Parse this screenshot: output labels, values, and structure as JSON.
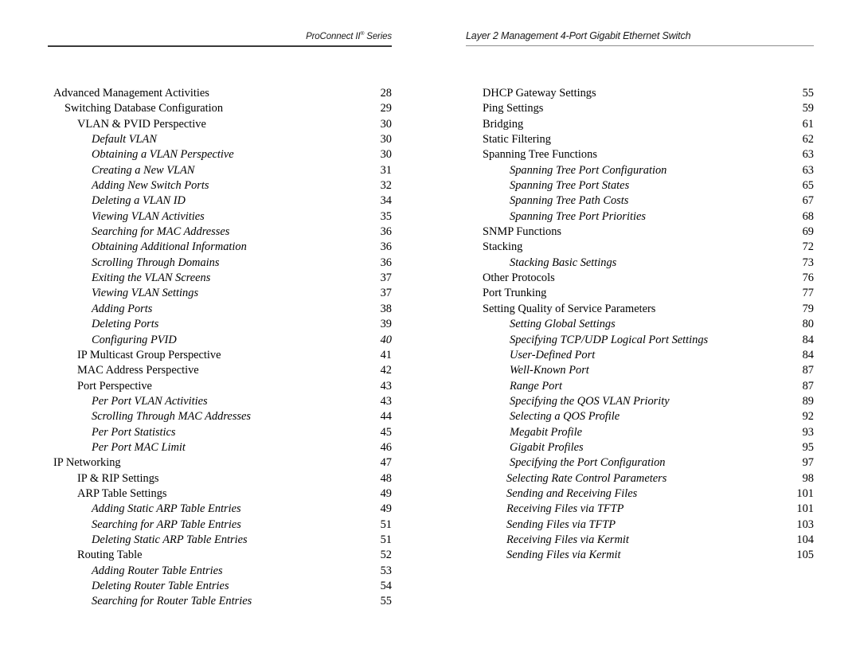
{
  "header": {
    "left_brand": "ProConnect II",
    "left_brand_mark": "®",
    "left_brand_suffix": " Series",
    "right_title": "Layer 2 Management 4-Port Gigabit Ethernet Switch"
  },
  "toc": {
    "left_column": [
      {
        "title": "Advanced Management Activities",
        "page": "28",
        "level": 1
      },
      {
        "title": "Switching Database Configuration",
        "page": "29",
        "level": 2
      },
      {
        "title": "VLAN & PVID Perspective",
        "page": "30",
        "level": 3
      },
      {
        "title": "Default VLAN",
        "page": "30",
        "level": 4
      },
      {
        "title": "Obtaining a VLAN Perspective",
        "page": "30",
        "level": 4
      },
      {
        "title": "Creating a New VLAN",
        "page": "31",
        "level": 4
      },
      {
        "title": "Adding New Switch Ports",
        "page": "32",
        "level": 4
      },
      {
        "title": "Deleting a VLAN ID",
        "page": "34",
        "level": 4
      },
      {
        "title": "Viewing VLAN Activities",
        "page": "35",
        "level": 4
      },
      {
        "title": "Searching for MAC Addresses",
        "page": "36",
        "level": 4
      },
      {
        "title": "Obtaining Additional Information",
        "page": "36",
        "level": 4
      },
      {
        "title": "Scrolling Through Domains",
        "page": "36",
        "level": 4
      },
      {
        "title": "Exiting the VLAN Screens",
        "page": "37",
        "level": 4
      },
      {
        "title": "Viewing VLAN Settings",
        "page": "37",
        "level": 4
      },
      {
        "title": "Adding Ports",
        "page": "38",
        "level": 4
      },
      {
        "title": "Deleting Ports",
        "page": "39",
        "level": 4
      },
      {
        "title": "Configuring PVID",
        "page": "40",
        "level": 4,
        "italic_page": true
      },
      {
        "title": "IP Multicast Group Perspective",
        "page": "41",
        "level": 3
      },
      {
        "title": "MAC Address Perspective",
        "page": "42",
        "level": 3
      },
      {
        "title": "Port Perspective",
        "page": "43",
        "level": 3
      },
      {
        "title": "Per Port VLAN Activities",
        "page": "43",
        "level": 4
      },
      {
        "title": "Scrolling Through MAC Addresses",
        "page": "44",
        "level": 4
      },
      {
        "title": "Per Port Statistics",
        "page": "45",
        "level": 4
      },
      {
        "title": "Per Port MAC Limit",
        "page": "46",
        "level": 4
      },
      {
        "title": "IP Networking",
        "page": "47",
        "level": 1
      },
      {
        "title": "IP & RIP Settings",
        "page": "48",
        "level": 3
      },
      {
        "title": "ARP Table Settings",
        "page": "49",
        "level": 3
      },
      {
        "title": "Adding Static ARP Table Entries",
        "page": "49",
        "level": 4
      },
      {
        "title": "Searching for ARP Table Entries",
        "page": "51",
        "level": 4
      },
      {
        "title": "Deleting Static ARP Table Entries",
        "page": "51",
        "level": 4
      },
      {
        "title": "Routing Table",
        "page": "52",
        "level": 3
      },
      {
        "title": "Adding Router Table Entries",
        "page": "53",
        "level": 4
      },
      {
        "title": "Deleting Router Table Entries",
        "page": "54",
        "level": 4
      },
      {
        "title": "Searching for Router Table Entries",
        "page": "55",
        "level": 4
      }
    ],
    "right_column": [
      {
        "title": "DHCP Gateway Settings",
        "page": "55",
        "level": 2
      },
      {
        "title": "Ping Settings",
        "page": "59",
        "level": 2
      },
      {
        "title": "Bridging",
        "page": "61",
        "level": 2
      },
      {
        "title": "Static Filtering",
        "page": "62",
        "level": 2
      },
      {
        "title": "Spanning Tree Functions",
        "page": "63",
        "level": 2
      },
      {
        "title": "Spanning Tree Port Configuration",
        "page": "63",
        "level": 4
      },
      {
        "title": "Spanning Tree Port States",
        "page": "65",
        "level": 4
      },
      {
        "title": "Spanning Tree Path Costs",
        "page": "67",
        "level": 4
      },
      {
        "title": "Spanning Tree Port Priorities",
        "page": "68",
        "level": 4
      },
      {
        "title": "SNMP Functions",
        "page": "69",
        "level": 2
      },
      {
        "title": "Stacking",
        "page": "72",
        "level": 2
      },
      {
        "title": "Stacking Basic Settings",
        "page": "73",
        "level": 4
      },
      {
        "title": "Other Protocols",
        "page": "76",
        "level": 2
      },
      {
        "title": "Port Trunking",
        "page": "77",
        "level": 2
      },
      {
        "title": "Setting Quality of Service Parameters",
        "page": "79",
        "level": 2
      },
      {
        "title": "Setting Global Settings",
        "page": "80",
        "level": 4
      },
      {
        "title": "Specifying TCP/UDP Logical Port Settings",
        "page": "84",
        "level": 4
      },
      {
        "title": "User-Defined Port",
        "page": "84",
        "level": 4
      },
      {
        "title": "Well-Known Port",
        "page": "87",
        "level": 4
      },
      {
        "title": "Range Port",
        "page": "87",
        "level": 4
      },
      {
        "title": "Specifying the QOS VLAN Priority",
        "page": "89",
        "level": 4
      },
      {
        "title": "Selecting a QOS Profile",
        "page": "92",
        "level": 4
      },
      {
        "title": "Megabit Profile",
        "page": "93",
        "level": 4
      },
      {
        "title": "Gigabit Profiles",
        "page": "95",
        "level": 4
      },
      {
        "title": "Specifying the Port Configuration",
        "page": "97",
        "level": 4
      },
      {
        "title": "Selecting Rate Control Parameters",
        "page": "98",
        "level": "4b"
      },
      {
        "title": "Sending and Receiving Files",
        "page": "101",
        "level": "4b"
      },
      {
        "title": "Receiving Files via TFTP",
        "page": "101",
        "level": "4b"
      },
      {
        "title": "Sending Files via TFTP",
        "page": "103",
        "level": "4b"
      },
      {
        "title": "Receiving Files via Kermit",
        "page": "104",
        "level": "4b"
      },
      {
        "title": "Sending Files via Kermit",
        "page": "105",
        "level": "4b"
      }
    ]
  }
}
